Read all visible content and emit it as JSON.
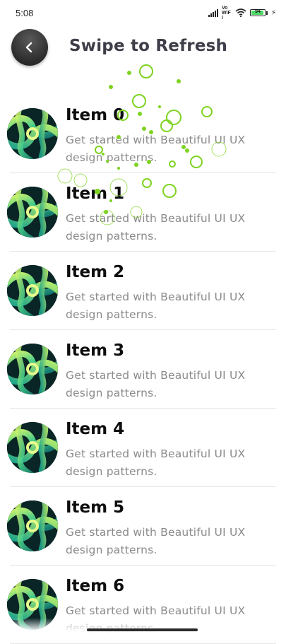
{
  "status_bar": {
    "time": "5:08",
    "network": "Vo WiFi",
    "battery": "94",
    "battery_level": 0.94,
    "icons": [
      "signal-icon",
      "wifi-icon",
      "battery-icon",
      "charging-bolt-icon"
    ]
  },
  "header": {
    "title": "Swipe to Refresh",
    "back_icon": "chevron-left-icon"
  },
  "items": [
    {
      "title": "Item 0",
      "description": "Get started with Beautiful UI UX design patterns."
    },
    {
      "title": "Item 1",
      "description": "Get started with Beautiful UI UX design patterns."
    },
    {
      "title": "Item 2",
      "description": "Get started with Beautiful UI UX design patterns."
    },
    {
      "title": "Item 3",
      "description": "Get started with Beautiful UI UX design patterns."
    },
    {
      "title": "Item 4",
      "description": "Get started with Beautiful UI UX design patterns."
    },
    {
      "title": "Item 5",
      "description": "Get started with Beautiful UI UX design patterns."
    },
    {
      "title": "Item 6",
      "description": "Get started with Beautiful UI UX design patterns."
    }
  ],
  "colors": {
    "accent_green": "#7ed321",
    "title_dark": "#3e3e48",
    "text_grey": "#8a8a8a"
  }
}
